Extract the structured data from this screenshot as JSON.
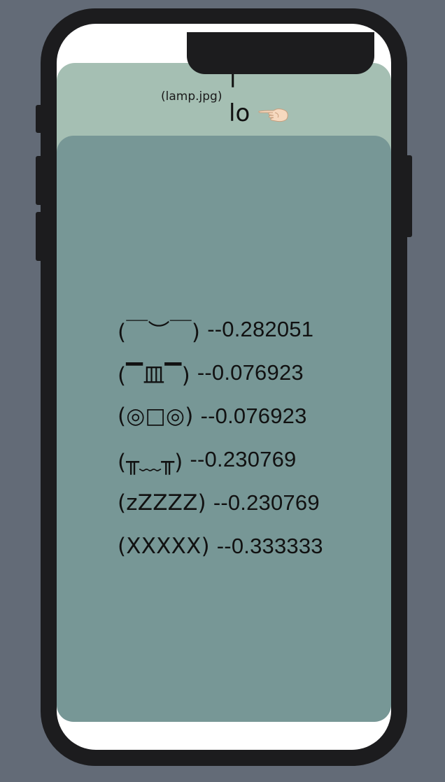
{
  "header": {
    "caption": "(lamp.jpg)",
    "title_line1": "l",
    "title_line2": "lo",
    "pointer_icon": "hand-pointing-left-icon"
  },
  "results": [
    {
      "label": "(￣︶￣)",
      "score": "--0.282051"
    },
    {
      "label": "(▔皿▔)",
      "score": "--0.076923"
    },
    {
      "label": "(◎□◎)",
      "score": "--0.076923"
    },
    {
      "label": "(╥﹏╥)",
      "score": "--0.230769"
    },
    {
      "label": "(zZZZZ)",
      "score": "--0.230769"
    },
    {
      "label": "(XXXXX)",
      "score": "--0.333333"
    }
  ],
  "colors": {
    "background": "#636b77",
    "phone_frame": "#1c1c1e",
    "header_card": "#a5bfb3",
    "results_card": "#779796"
  }
}
